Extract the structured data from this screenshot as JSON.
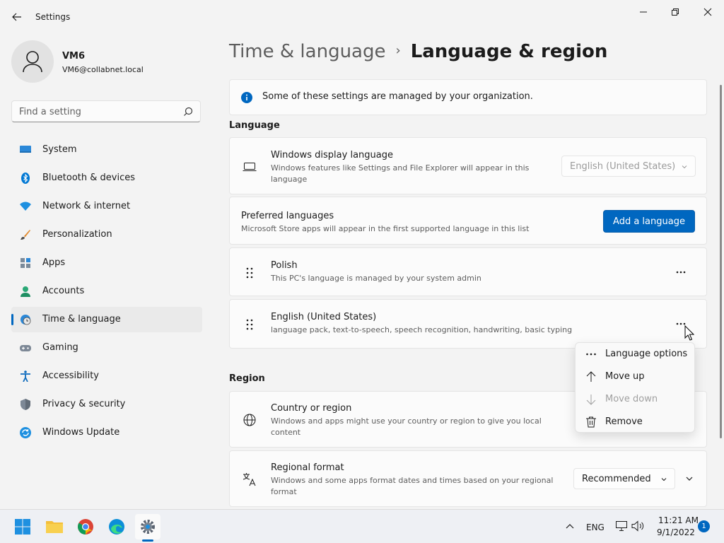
{
  "window": {
    "title": "Settings"
  },
  "user": {
    "name": "VM6",
    "email": "VM6@collabnet.local"
  },
  "search": {
    "placeholder": "Find a setting"
  },
  "sidebar": {
    "items": [
      {
        "label": "System",
        "icon": "system-icon"
      },
      {
        "label": "Bluetooth & devices",
        "icon": "bluetooth-icon"
      },
      {
        "label": "Network & internet",
        "icon": "wifi-icon"
      },
      {
        "label": "Personalization",
        "icon": "brush-icon"
      },
      {
        "label": "Apps",
        "icon": "apps-icon"
      },
      {
        "label": "Accounts",
        "icon": "person-icon"
      },
      {
        "label": "Time & language",
        "icon": "globe-clock-icon",
        "active": true
      },
      {
        "label": "Gaming",
        "icon": "gamepad-icon"
      },
      {
        "label": "Accessibility",
        "icon": "accessibility-icon"
      },
      {
        "label": "Privacy & security",
        "icon": "shield-icon"
      },
      {
        "label": "Windows Update",
        "icon": "update-icon"
      }
    ]
  },
  "breadcrumb": {
    "parent": "Time & language",
    "separator": "›",
    "current": "Language & region"
  },
  "notice": {
    "text": "Some of these settings are managed by your organization."
  },
  "language": {
    "heading": "Language",
    "display": {
      "title": "Windows display language",
      "desc": "Windows features like Settings and File Explorer will appear in this language",
      "value": "English (United States)"
    },
    "preferred": {
      "title": "Preferred languages",
      "desc": "Microsoft Store apps will appear in the first supported language in this list",
      "button": "Add a language"
    },
    "items": [
      {
        "name": "Polish",
        "desc": "This PC's language is managed by your system admin"
      },
      {
        "name": "English (United States)",
        "desc": "language pack, text-to-speech, speech recognition, handwriting, basic typing"
      }
    ]
  },
  "context_menu": {
    "items": [
      {
        "label": "Language options",
        "icon": "more-icon",
        "disabled": false
      },
      {
        "label": "Move up",
        "icon": "arrow-up-icon",
        "disabled": false
      },
      {
        "label": "Move down",
        "icon": "arrow-down-icon",
        "disabled": true
      },
      {
        "label": "Remove",
        "icon": "trash-icon",
        "disabled": false
      }
    ]
  },
  "region": {
    "heading": "Region",
    "country": {
      "title": "Country or region",
      "desc": "Windows and apps might use your country or region to give you local content"
    },
    "format": {
      "title": "Regional format",
      "desc": "Windows and some apps format dates and times based on your regional format",
      "value": "Recommended"
    }
  },
  "taskbar": {
    "lang": "ENG",
    "time": "11:21 AM",
    "date": "9/1/2022",
    "notifications": "1"
  },
  "colors": {
    "accent": "#0067c0"
  }
}
